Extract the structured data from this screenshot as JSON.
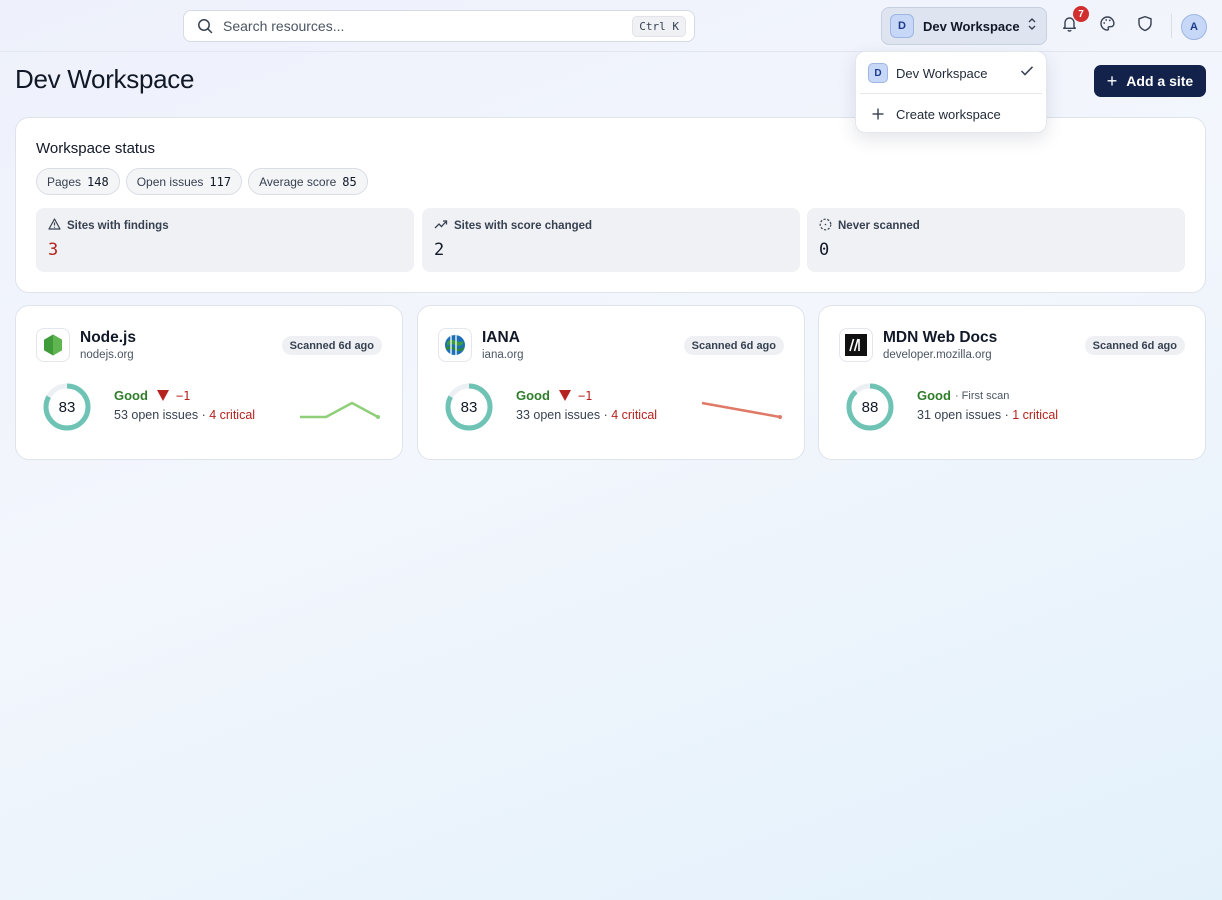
{
  "search": {
    "placeholder": "Search resources...",
    "shortcut": "Ctrl K"
  },
  "workspace_switcher": {
    "initial": "D",
    "name": "Dev Workspace"
  },
  "notifications": {
    "count": "7"
  },
  "user": {
    "initial": "A"
  },
  "dropdown": {
    "items": [
      {
        "initial": "D",
        "label": "Dev Workspace",
        "selected": true
      },
      {
        "label": "Create workspace"
      }
    ]
  },
  "page": {
    "title": "Dev Workspace",
    "add_site_label": "Add a site"
  },
  "status": {
    "title": "Workspace status",
    "pills": [
      {
        "label": "Pages",
        "value": "148"
      },
      {
        "label": "Open issues",
        "value": "117"
      },
      {
        "label": "Average score",
        "value": "85"
      }
    ],
    "stats": [
      {
        "label": "Sites with findings",
        "value": "3",
        "icon": "warning-icon",
        "color": "#b5231e"
      },
      {
        "label": "Sites with score changed",
        "value": "2",
        "icon": "trending-icon",
        "color": "#111827"
      },
      {
        "label": "Never scanned",
        "value": "0",
        "icon": "dashed-circle-icon",
        "color": "#111827"
      }
    ]
  },
  "sites": [
    {
      "name": "Node.js",
      "domain": "nodejs.org",
      "scanned": "Scanned 6d ago",
      "score": 83,
      "grade": "Good",
      "delta": "−1",
      "issues": "53 open issues",
      "separator": " · ",
      "critical": "4 critical",
      "trend": [
        83,
        83,
        84,
        83
      ],
      "trend_color": "#8fcf7a",
      "logo": "nodejs-logo-icon"
    },
    {
      "name": "IANA",
      "domain": "iana.org",
      "scanned": "Scanned 6d ago",
      "score": 83,
      "grade": "Good",
      "delta": "−1",
      "issues": "33 open issues",
      "separator": " · ",
      "critical": "4 critical",
      "trend": [
        84,
        83
      ],
      "trend_color": "#e07a68",
      "logo": "iana-logo-icon"
    },
    {
      "name": "MDN Web Docs",
      "domain": "developer.mozilla.org",
      "scanned": "Scanned 6d ago",
      "score": 88,
      "grade": "Good",
      "first_scan": "· First scan",
      "issues": "31 open issues",
      "separator": " · ",
      "critical": "1 critical",
      "logo": "mdn-logo-icon"
    }
  ],
  "colors": {
    "ring": "#6ec3b4",
    "ring_track": "#eceff3",
    "accent_button": "#13224a",
    "danger": "#b5231e",
    "good": "#2f7d2a"
  }
}
